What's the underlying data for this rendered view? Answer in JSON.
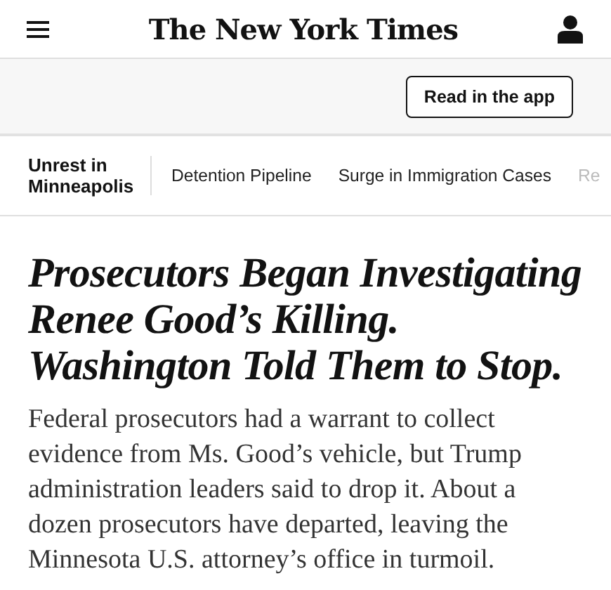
{
  "masthead": {
    "logo": "The New York Times"
  },
  "promo": {
    "button": "Read in the app"
  },
  "topic_bar": {
    "label": "Unrest in Minneapolis",
    "links": [
      "Detention Pipeline",
      "Surge in Immigration Cases",
      "Re"
    ]
  },
  "article": {
    "headline": "Prosecutors Began Investigating Renee Good’s Killing. Washington Told Them to Stop.",
    "summary": "Federal prosecutors had a warrant to collect evidence from Ms. Good’s vehicle, but Trump administration leaders said to drop it. About a dozen prosecutors have departed, leaving the Minnesota U.S. attorney’s office in turmoil."
  }
}
